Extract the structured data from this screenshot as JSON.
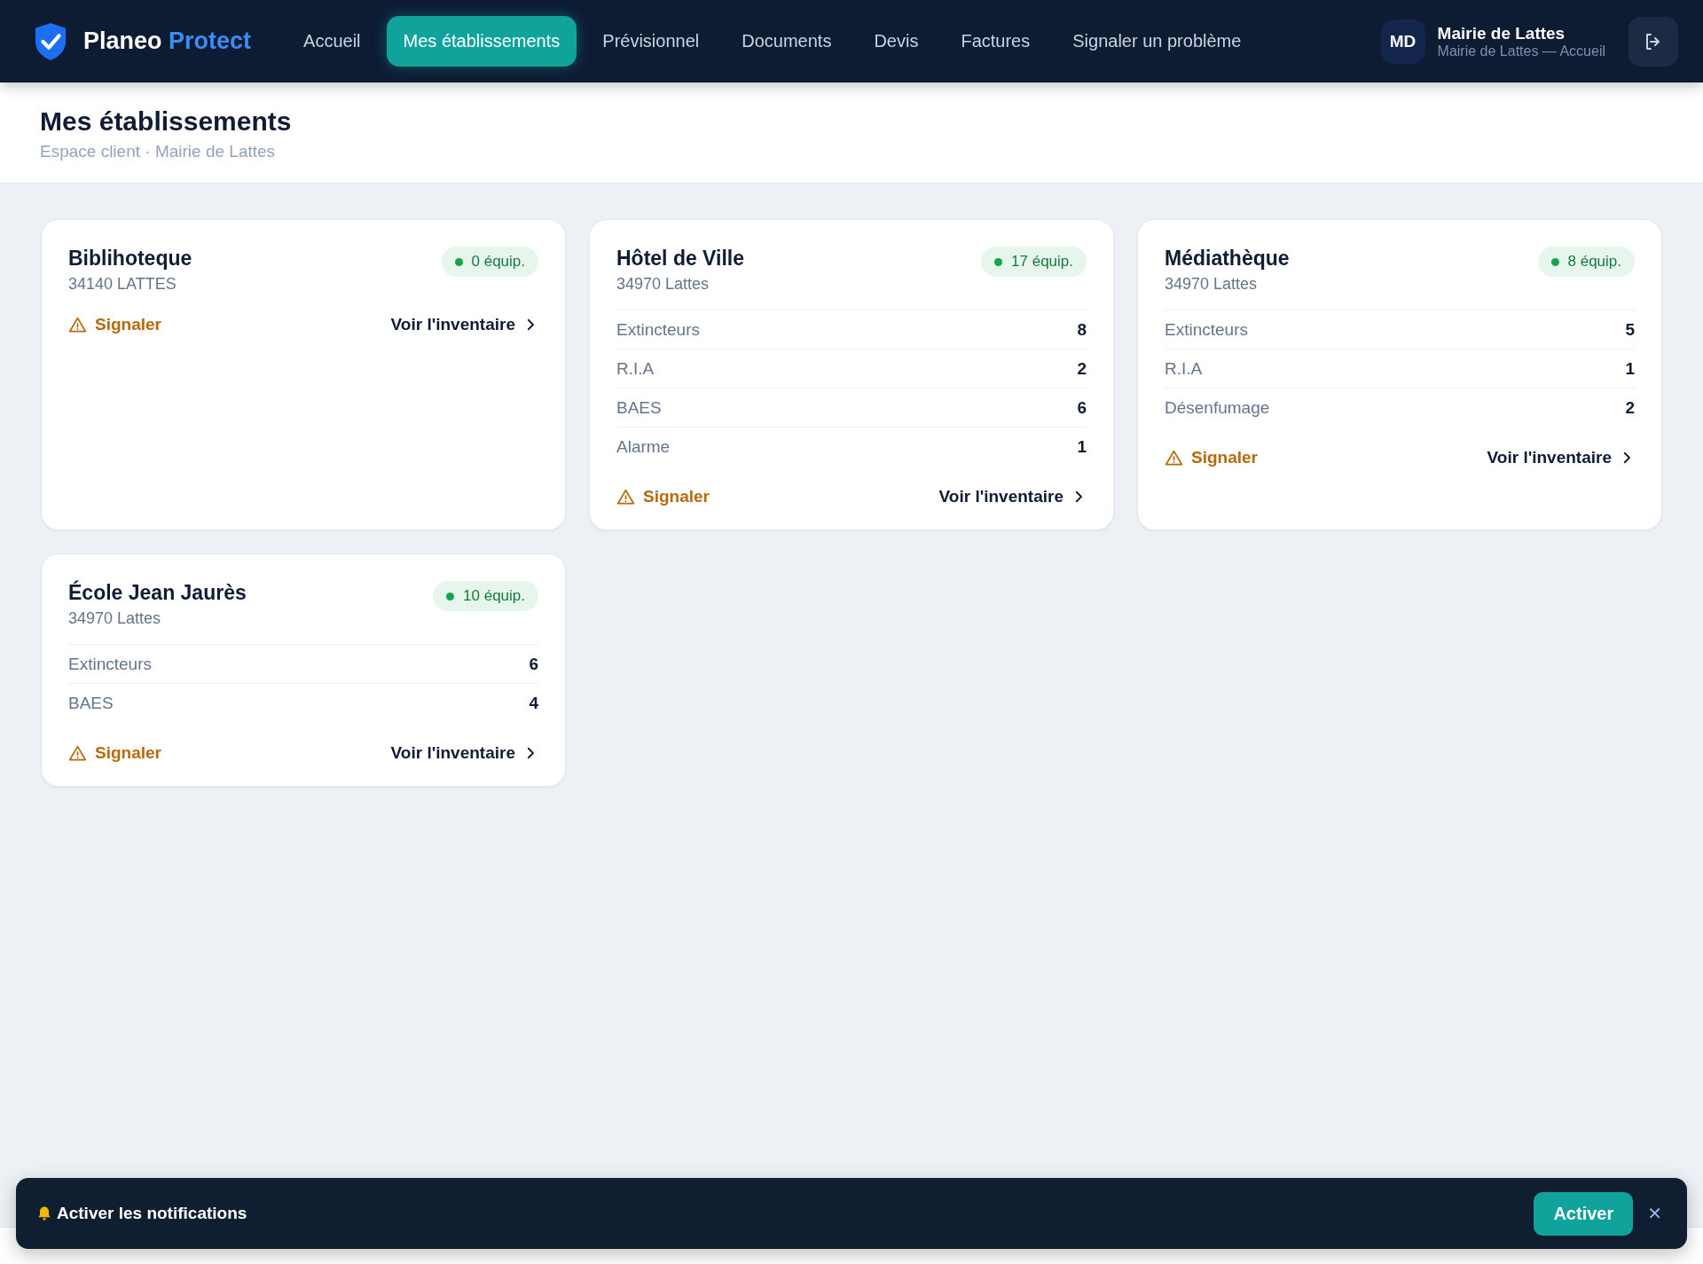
{
  "brand": {
    "name": "Planeo",
    "accent": "Protect"
  },
  "nav": [
    {
      "label": "Accueil",
      "selected": false
    },
    {
      "label": "Mes établissements",
      "selected": true
    },
    {
      "label": "Prévisionnel",
      "selected": false
    },
    {
      "label": "Documents",
      "selected": false
    },
    {
      "label": "Devis",
      "selected": false
    },
    {
      "label": "Factures",
      "selected": false
    },
    {
      "label": "Signaler un problème",
      "selected": false
    }
  ],
  "user": {
    "initials": "MD",
    "name": "Mairie de Lattes",
    "subtitle": "Mairie de Lattes — Accueil"
  },
  "page": {
    "title": "Mes établissements",
    "breadcrumb": "Espace client · Mairie de Lattes"
  },
  "sites": [
    {
      "name": "Biblihoteque",
      "address": "34140 LATTES",
      "badge": "0 équip.",
      "report": "Signaler",
      "inventory": "Voir l'inventaire"
    },
    {
      "name": "Hôtel de Ville",
      "address": "34970 Lattes",
      "badge": "17 équip.",
      "equipment": [
        {
          "label": "Extincteurs",
          "count": "8"
        },
        {
          "label": "R.I.A",
          "count": "2"
        },
        {
          "label": "BAES",
          "count": "6"
        },
        {
          "label": "Alarme",
          "count": "1"
        }
      ],
      "report": "Signaler",
      "inventory": "Voir l'inventaire"
    },
    {
      "name": "Médiathèque",
      "address": "34970 Lattes",
      "badge": "8 équip.",
      "equipment": [
        {
          "label": "Extincteurs",
          "count": "5"
        },
        {
          "label": "R.I.A",
          "count": "1"
        },
        {
          "label": "Désenfumage",
          "count": "2"
        }
      ],
      "report": "Signaler",
      "inventory": "Voir l'inventaire"
    },
    {
      "name": "École Jean Jaurès",
      "address": "34970 Lattes",
      "badge": "10 équip.",
      "equipment": [
        {
          "label": "Extincteurs",
          "count": "6"
        },
        {
          "label": "BAES",
          "count": "4"
        }
      ],
      "report": "Signaler",
      "inventory": "Voir l'inventaire"
    }
  ],
  "notification": {
    "message": "Activer les notifications",
    "action": "Activer",
    "close": "✕"
  }
}
